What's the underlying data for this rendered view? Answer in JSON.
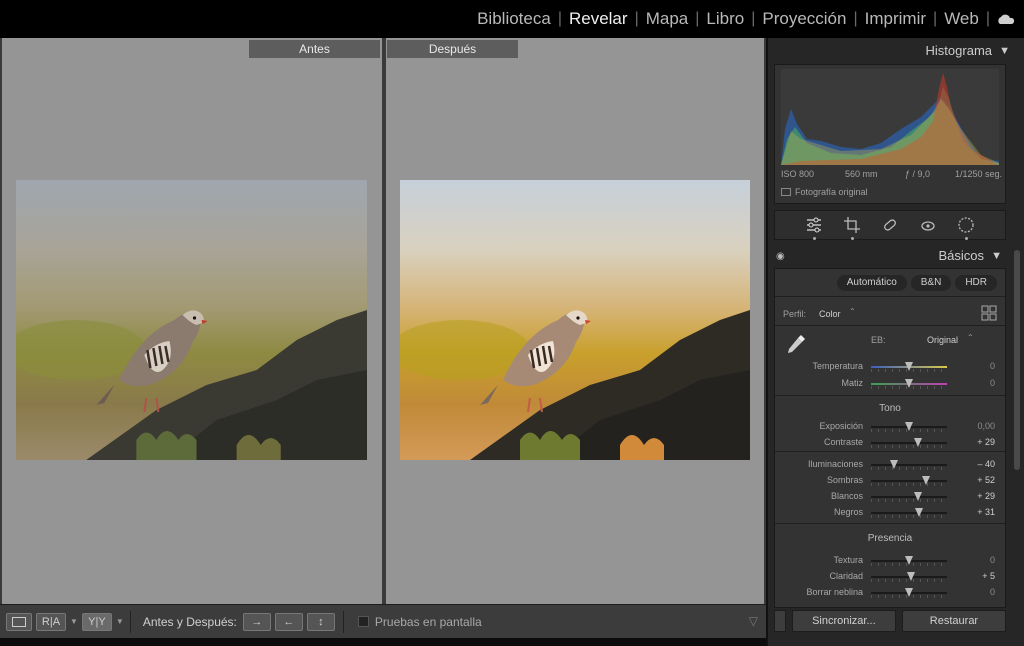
{
  "modules": [
    {
      "label": "Biblioteca",
      "active": false
    },
    {
      "label": "Revelar",
      "active": true
    },
    {
      "label": "Mapa",
      "active": false
    },
    {
      "label": "Libro",
      "active": false
    },
    {
      "label": "Proyección",
      "active": false
    },
    {
      "label": "Imprimir",
      "active": false
    },
    {
      "label": "Web",
      "active": false
    }
  ],
  "compare": {
    "before_label": "Antes",
    "after_label": "Después"
  },
  "toolbar": {
    "before_after_label": "Antes y Después:",
    "proof_label": "Pruebas en pantalla",
    "view_ra": "R|A",
    "view_yy": "Y|Y"
  },
  "histogram": {
    "title": "Histograma",
    "iso": "ISO 800",
    "focal": "560 mm",
    "aperture": "ƒ / 9,0",
    "shutter": "1/1250 seg.",
    "original_photo": "Fotografía original"
  },
  "basics": {
    "title": "Básicos",
    "auto": "Automático",
    "bw": "B&N",
    "hdr": "HDR",
    "profile_label": "Perfil:",
    "profile_value": "Color",
    "wb_label": "EB:",
    "wb_value": "Original",
    "tone_title": "Tono",
    "presence_title": "Presencia",
    "sliders_wb": [
      {
        "name": "Temperatura",
        "value": "0",
        "pos": 0.5,
        "zero": true,
        "track": "temp"
      },
      {
        "name": "Matiz",
        "value": "0",
        "pos": 0.5,
        "zero": true,
        "track": "tint"
      }
    ],
    "sliders_tone1": [
      {
        "name": "Exposición",
        "value": "0,00",
        "pos": 0.5,
        "zero": true
      },
      {
        "name": "Contraste",
        "value": "+ 29",
        "pos": 0.62,
        "zero": false
      }
    ],
    "sliders_tone2": [
      {
        "name": "Iluminaciones",
        "value": "– 40",
        "pos": 0.3,
        "zero": false
      },
      {
        "name": "Sombras",
        "value": "+ 52",
        "pos": 0.72,
        "zero": false
      },
      {
        "name": "Blancos",
        "value": "+ 29",
        "pos": 0.62,
        "zero": false
      },
      {
        "name": "Negros",
        "value": "+ 31",
        "pos": 0.63,
        "zero": false
      }
    ],
    "sliders_presence": [
      {
        "name": "Textura",
        "value": "0",
        "pos": 0.5,
        "zero": true
      },
      {
        "name": "Claridad",
        "value": "+ 5",
        "pos": 0.52,
        "zero": false
      },
      {
        "name": "Borrar neblina",
        "value": "0",
        "pos": 0.5,
        "zero": true
      }
    ]
  },
  "bottom": {
    "sync": "Sincronizar...",
    "reset": "Restaurar"
  }
}
